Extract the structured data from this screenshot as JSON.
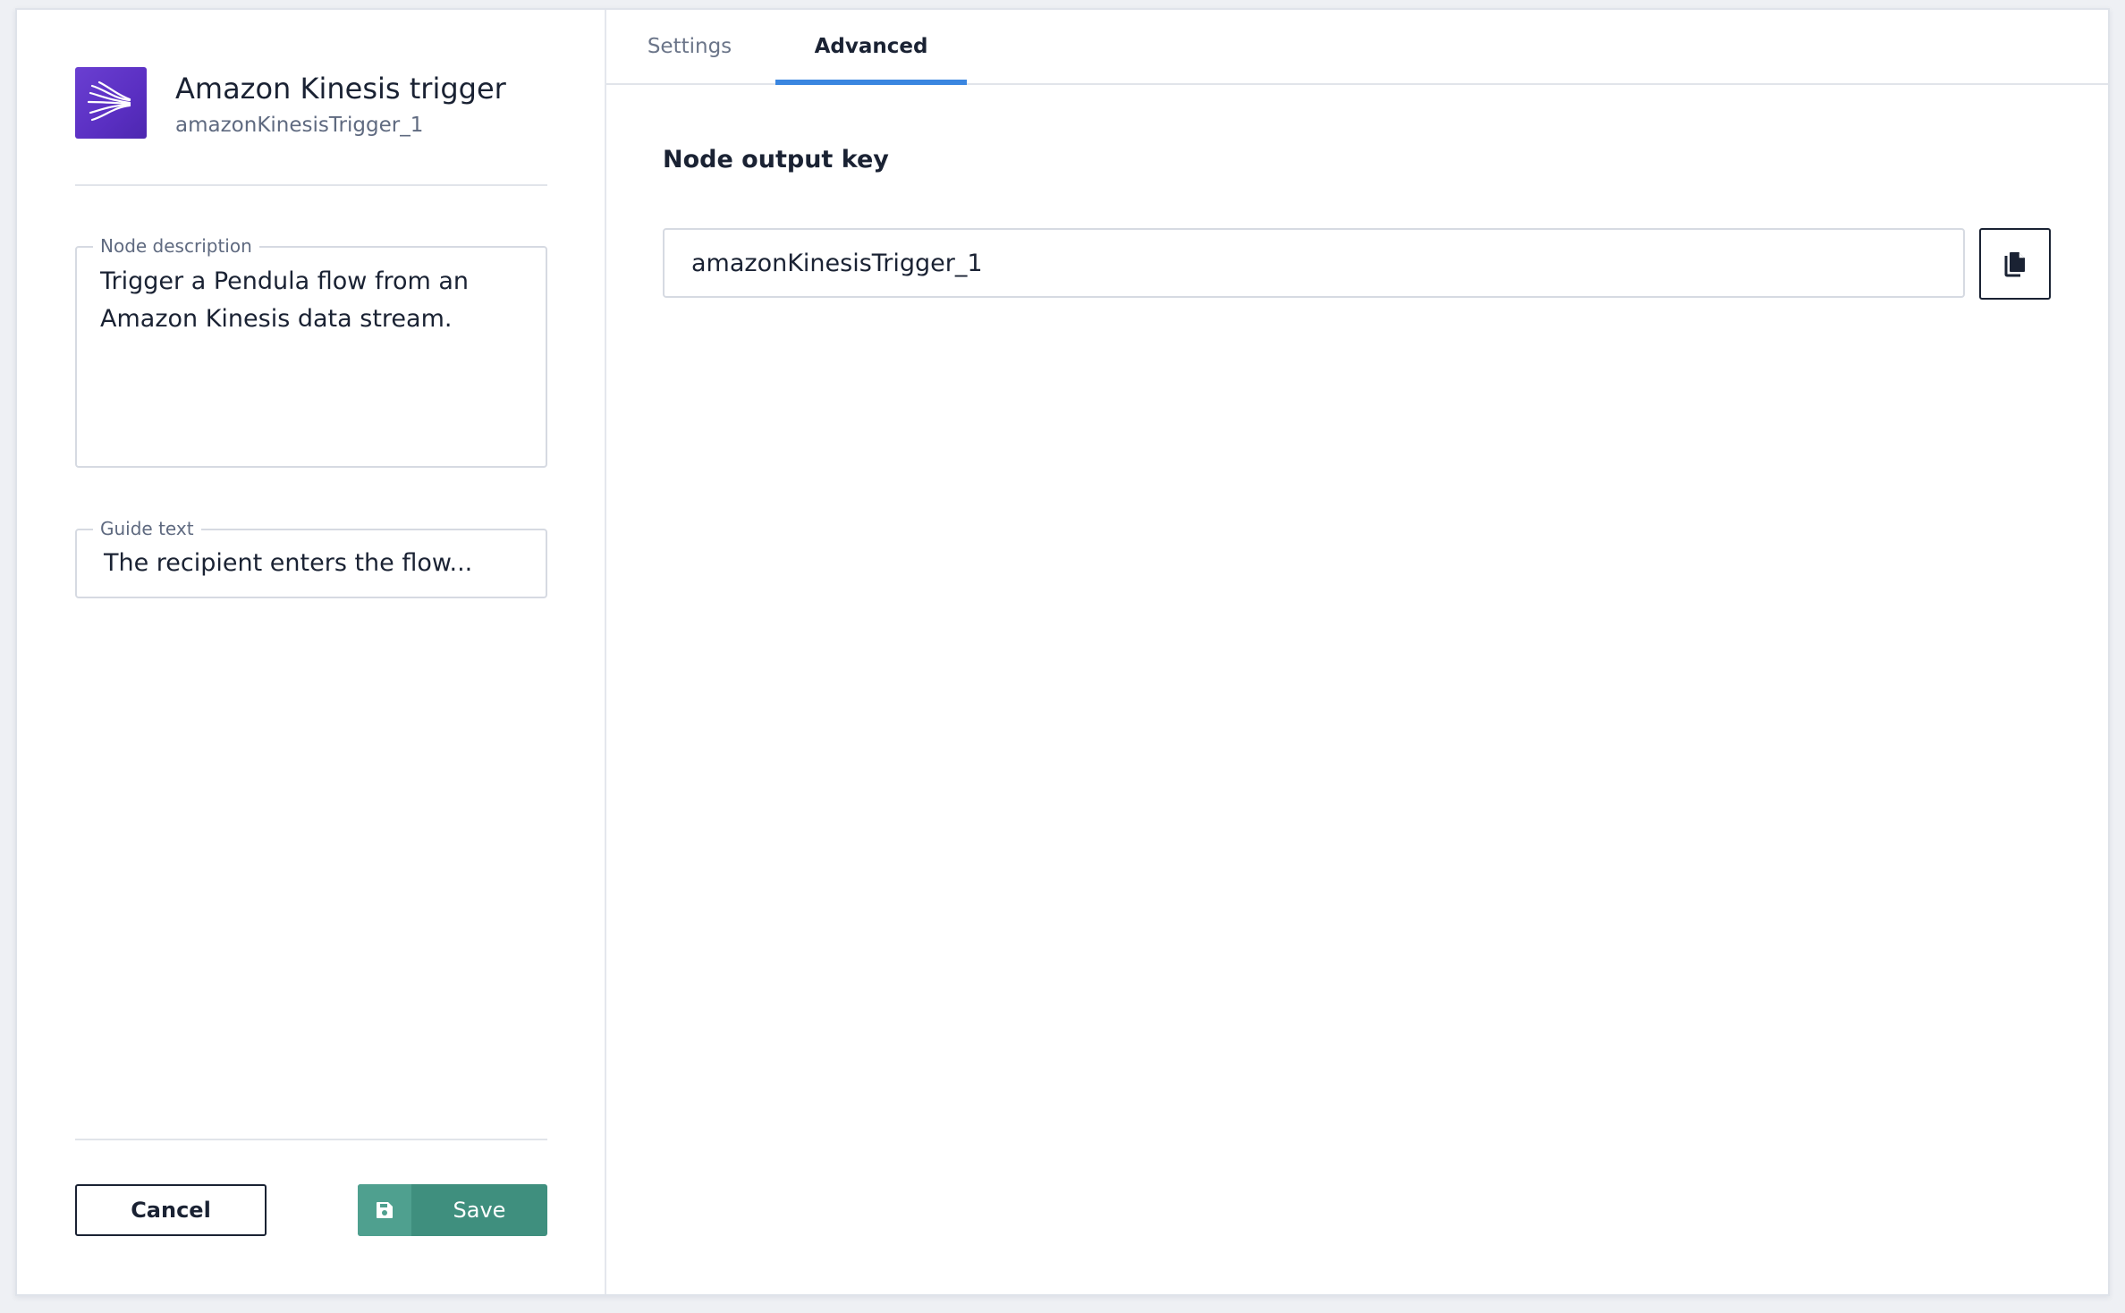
{
  "modal": {
    "node": {
      "title": "Amazon Kinesis trigger",
      "subtitle": "amazonKinesisTrigger_1",
      "icon": "kinesis-stream-icon",
      "icon_color": "#5a2fc2"
    },
    "node_description": {
      "label": "Node description",
      "value": "Trigger a Pendula flow from an Amazon Kinesis data stream."
    },
    "guide_text": {
      "label": "Guide text",
      "value": "The recipient enters the flow..."
    },
    "buttons": {
      "cancel_label": "Cancel",
      "save_label": "Save",
      "save_color": "#3f8f7e"
    },
    "tabs": [
      {
        "label": "Settings",
        "active": false
      },
      {
        "label": "Advanced",
        "active": true
      }
    ],
    "tab_accent_color": "#3a86e0",
    "advanced": {
      "section_title": "Node output key",
      "output_key_value": "amazonKinesisTrigger_1",
      "copy_icon": "copy-icon"
    }
  }
}
